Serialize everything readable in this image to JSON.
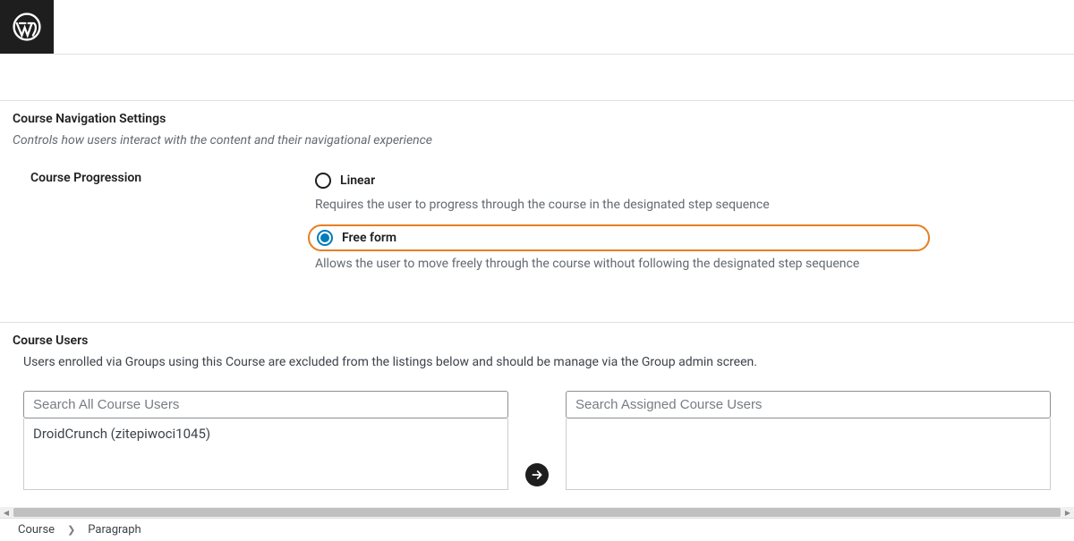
{
  "nav_section": {
    "title": "Course Navigation Settings",
    "description": "Controls how users interact with the content and their navigational experience",
    "progression_label": "Course Progression",
    "options": {
      "linear": {
        "label": "Linear",
        "desc": "Requires the user to progress through the course in the designated step sequence"
      },
      "freeform": {
        "label": "Free form",
        "desc": "Allows the user to move freely through the course without following the designated step sequence"
      }
    }
  },
  "users_section": {
    "title": "Course Users",
    "description": "Users enrolled via Groups using this Course are excluded from the listings below and should be manage via the Group admin screen.",
    "search_all_placeholder": "Search All Course Users",
    "search_assigned_placeholder": "Search Assigned Course Users",
    "all_users": [
      "DroidCrunch (zitepiwoci1045)"
    ]
  },
  "breadcrumb": {
    "root": "Course",
    "leaf": "Paragraph"
  }
}
